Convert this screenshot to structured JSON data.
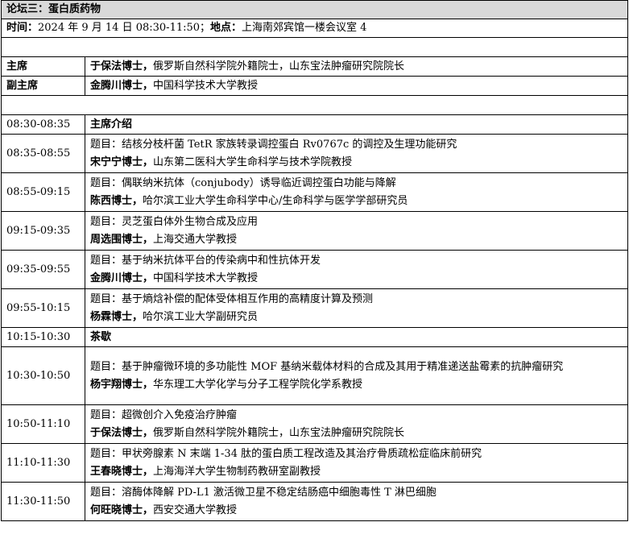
{
  "forum_title": "论坛三：蛋白质药物",
  "time_label": "时间：",
  "time_value": "2024 年 9 月 14 日 08:30-11:50；",
  "location_label": "地点：",
  "location_value": "上海南郊宾馆一楼会议室 4",
  "chair": {
    "label": "主席",
    "name": "于保法博士，",
    "desc": "俄罗斯自然科学院外籍院士，山东宝法肿瘤研究院院长"
  },
  "vice_chair": {
    "label": "副主席",
    "name": "金腾川博士，",
    "desc": "中国科学技术大学教授"
  },
  "schedule": [
    {
      "time": "08:30-08:35",
      "title": "主席介绍"
    },
    {
      "time": "08:35-08:55",
      "topic": "题目：结核分枝杆菌 TetR 家族转录调控蛋白 Rv0767c 的调控及生理功能研究",
      "speaker": "宋宁宁博士，",
      "affil": "山东第二医科大学生命科学与技术学院教授"
    },
    {
      "time": "08:55-09:15",
      "topic": "题目：偶联纳米抗体（conjubody）诱导临近调控蛋白功能与降解",
      "speaker": "陈西博士，",
      "affil": "哈尔滨工业大学生命科学中心/生命科学与医学学部研究员"
    },
    {
      "time": "09:15-09:35",
      "topic": "题目：灵芝蛋白体外生物合成及应用",
      "speaker": "周选围博士，",
      "affil": "上海交通大学教授"
    },
    {
      "time": "09:35-09:55",
      "topic": "题目：基于纳米抗体平台的传染病中和性抗体开发",
      "speaker": "金腾川博士，",
      "affil": "中国科学技术大学教授"
    },
    {
      "time": "09:55-10:15",
      "topic": "题目：基于熵焓补偿的配体受体相互作用的高精度计算及预测",
      "speaker": "杨霖博士，",
      "affil": "哈尔滨工业大学副研究员"
    },
    {
      "time": "10:15-10:30",
      "title": "茶歇"
    },
    {
      "time": "10:30-10:50",
      "topic": "题目：基于肿瘤微环境的多功能性 MOF 基纳米载体材料的合成及其用于精准递送盐霉素的抗肿瘤研究",
      "speaker": "杨宇翔博士，",
      "affil": "华东理工大学化学与分子工程学院化学系教授"
    },
    {
      "time": "10:50-11:10",
      "topic": "题目：超微创介入免疫治疗肿瘤",
      "speaker": "于保法博士，",
      "affil": "俄罗斯自然科学院外籍院士，山东宝法肿瘤研究院院长"
    },
    {
      "time": "11:10-11:30",
      "topic": "题目：甲状旁腺素 N 末端 1-34 肽的蛋白质工程改造及其治疗骨质疏松症临床前研究",
      "speaker": "王春晓博士，",
      "affil": "上海海洋大学生物制药教研室副教授"
    },
    {
      "time": "11:30-11:50",
      "topic": "题目：溶酶体降解 PD-L1 激活微卫星不稳定结肠癌中细胞毒性 T 淋巴细胞",
      "speaker": "何旺晓博士，",
      "affil": "西安交通大学教授"
    }
  ]
}
